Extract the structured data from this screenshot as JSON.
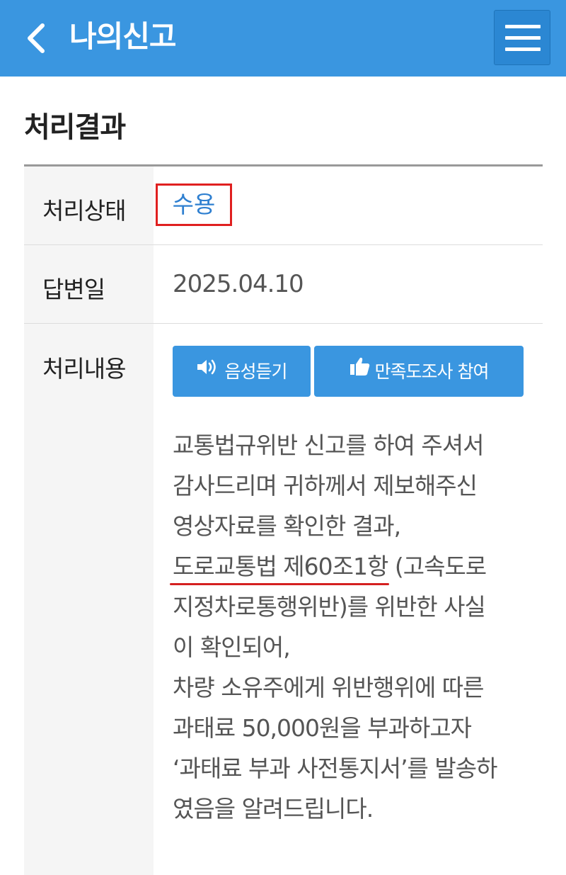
{
  "header": {
    "title": "나의신고",
    "back_icon": "chevron-left-icon",
    "menu_icon": "hamburger-menu-icon",
    "background": "#3a96e0"
  },
  "section": {
    "title": "처리결과"
  },
  "rows": {
    "status": {
      "label": "처리상태",
      "value": "수용",
      "value_color": "#2e7fd0",
      "highlight_color": "#e02020"
    },
    "answer_date": {
      "label": "답변일",
      "value": "2025.04.10"
    },
    "content": {
      "label": "처리내용"
    }
  },
  "actions": {
    "listen_label": "음성듣기",
    "listen_icon": "speaker-icon",
    "survey_label": "만족도조사 참여",
    "survey_icon": "thumbs-up-icon"
  },
  "body": {
    "line1": "교통법규위반 신고를 하여 주셔서",
    "line2": "감사드리며 귀하께서 제보해주신",
    "line3": "영상자료를 확인한 결과,",
    "line4_marked": "도로교통법 제60조1항",
    "line4_rest": " (고속도로",
    "line5": "지정차로통행위반)를 위반한 사실",
    "line6": "이 확인되어,",
    "line7": "차량 소유주에게 위반행위에 따른",
    "line8": "과태료 50,000원을 부과하고자",
    "line9": "‘과태료 부과 사전통지서’를 발송하",
    "line10": "였음을 알려드립니다."
  }
}
